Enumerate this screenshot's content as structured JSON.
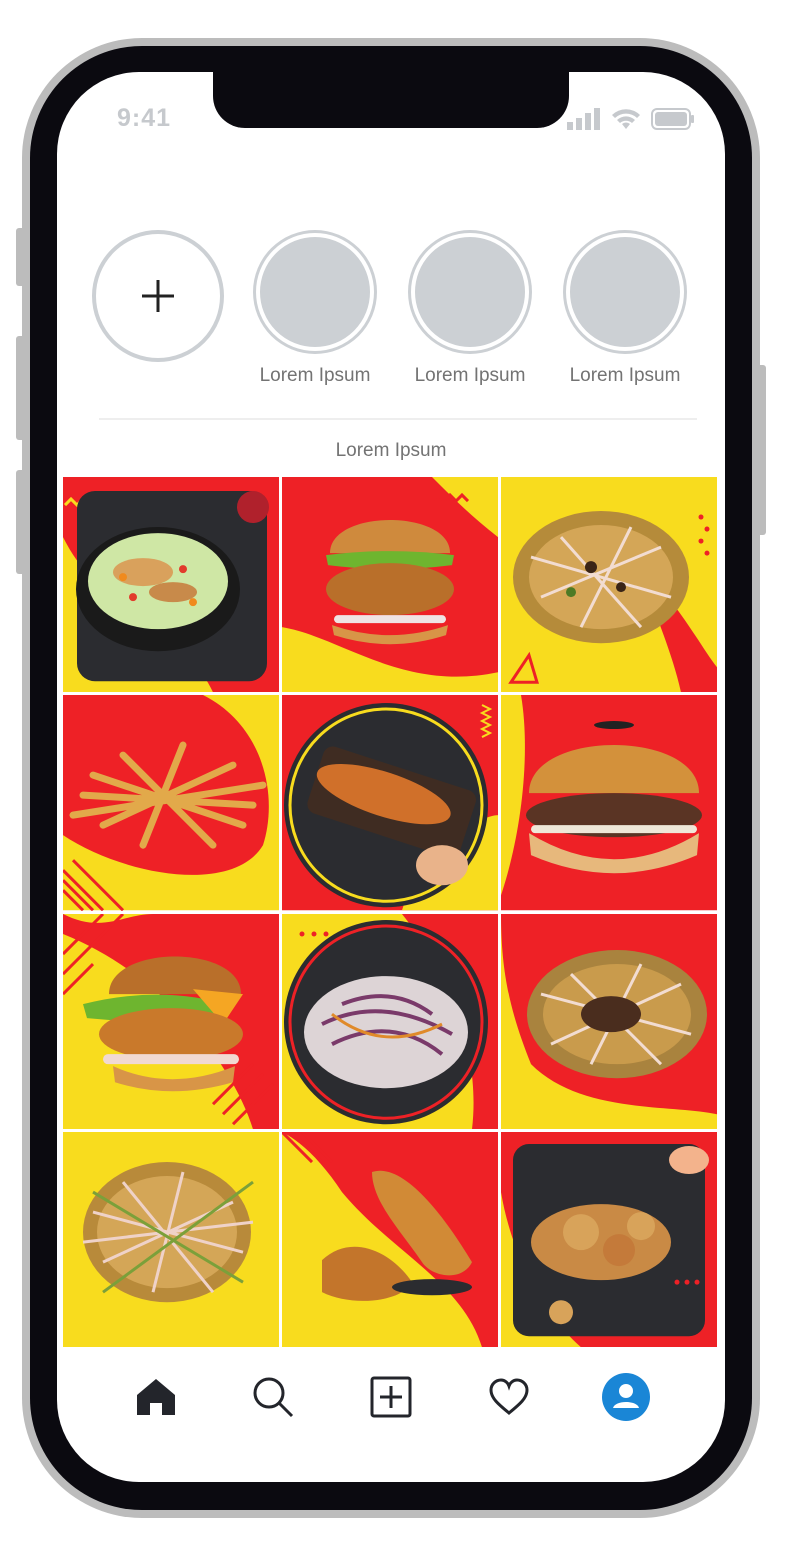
{
  "status_bar": {
    "time": "9:41",
    "signal_icon": "signal-icon",
    "wifi_icon": "wifi-icon",
    "battery_icon": "battery-icon"
  },
  "stories": {
    "add": {
      "icon": "plus-icon"
    },
    "items": [
      {
        "label": "Lorem Ipsum"
      },
      {
        "label": "Lorem Ipsum"
      },
      {
        "label": "Lorem Ipsum"
      }
    ]
  },
  "section": {
    "label": "Lorem Ipsum"
  },
  "grid": {
    "posts": [
      {
        "name": "salad-post"
      },
      {
        "name": "chicken-burger-post"
      },
      {
        "name": "loaded-fries-post"
      },
      {
        "name": "french-fries-post"
      },
      {
        "name": "chicken-wings-post"
      },
      {
        "name": "pulled-beef-burger-post"
      },
      {
        "name": "crispy-chicken-burger-post"
      },
      {
        "name": "coleslaw-post"
      },
      {
        "name": "beef-loaded-fries-post"
      },
      {
        "name": "sauce-fries-post"
      },
      {
        "name": "chicken-strips-post"
      },
      {
        "name": "chicken-bites-post"
      }
    ],
    "colors": {
      "red": "#ee2126",
      "yellow": "#f8dc1e",
      "dark": "#2b2c30"
    }
  },
  "bottom_nav": {
    "items": [
      {
        "icon": "home-icon"
      },
      {
        "icon": "search-icon"
      },
      {
        "icon": "add-post-icon"
      },
      {
        "icon": "heart-icon"
      },
      {
        "icon": "profile-icon",
        "color": "#1a86d6"
      }
    ]
  }
}
